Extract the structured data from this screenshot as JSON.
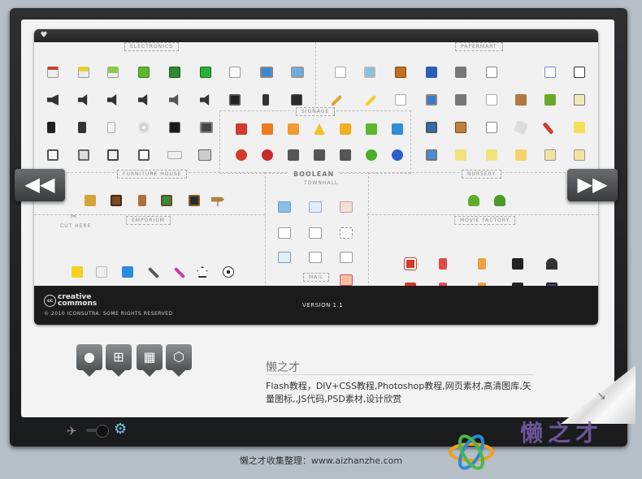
{
  "sections": {
    "electronics": "ELECTRONICS",
    "papermart": "PAPERMART",
    "signage": "SIGNAGE",
    "furniture_house": "FURNITURE HOUSE",
    "boolean": "BOOLEAN",
    "townhall": "TOWNHALL",
    "nursery": "NURSERY",
    "emporium": "EMPORIUM",
    "movie_factory": "MOVIE FACTORY",
    "mail": "MAIL",
    "cut_here": "CUT HERE"
  },
  "footer": {
    "cc_line1": "creative",
    "cc_line2": "commons",
    "cc_symbol": "cc",
    "copyright": "© 2010 ICONSUTRA. SOME RIGHTS RESERVED",
    "version": "VERSION 1.1"
  },
  "nav": {
    "prev_symbol": "◀◀",
    "next_symbol": "▶▶"
  },
  "os_buttons": [
    "apple-icon",
    "windows-icon",
    "checker-icon",
    "box-icon"
  ],
  "site": {
    "title": "懒之才",
    "description": "Flash教程，DIV+CSS教程,Photoshop教程,网页素材,高清图库,矢量图标,,JS代码,PSD素材,设计欣赏"
  },
  "credit": "懒之才收集整理：www.aizhanzhe.com",
  "watermark": "懒之才",
  "colors": {
    "device": "#222324",
    "screen": "#f3f3f3",
    "accent_red": "#d23b2a",
    "accent_orange": "#f0a020",
    "accent_green": "#5cb82c",
    "accent_blue": "#2f6fc8"
  }
}
